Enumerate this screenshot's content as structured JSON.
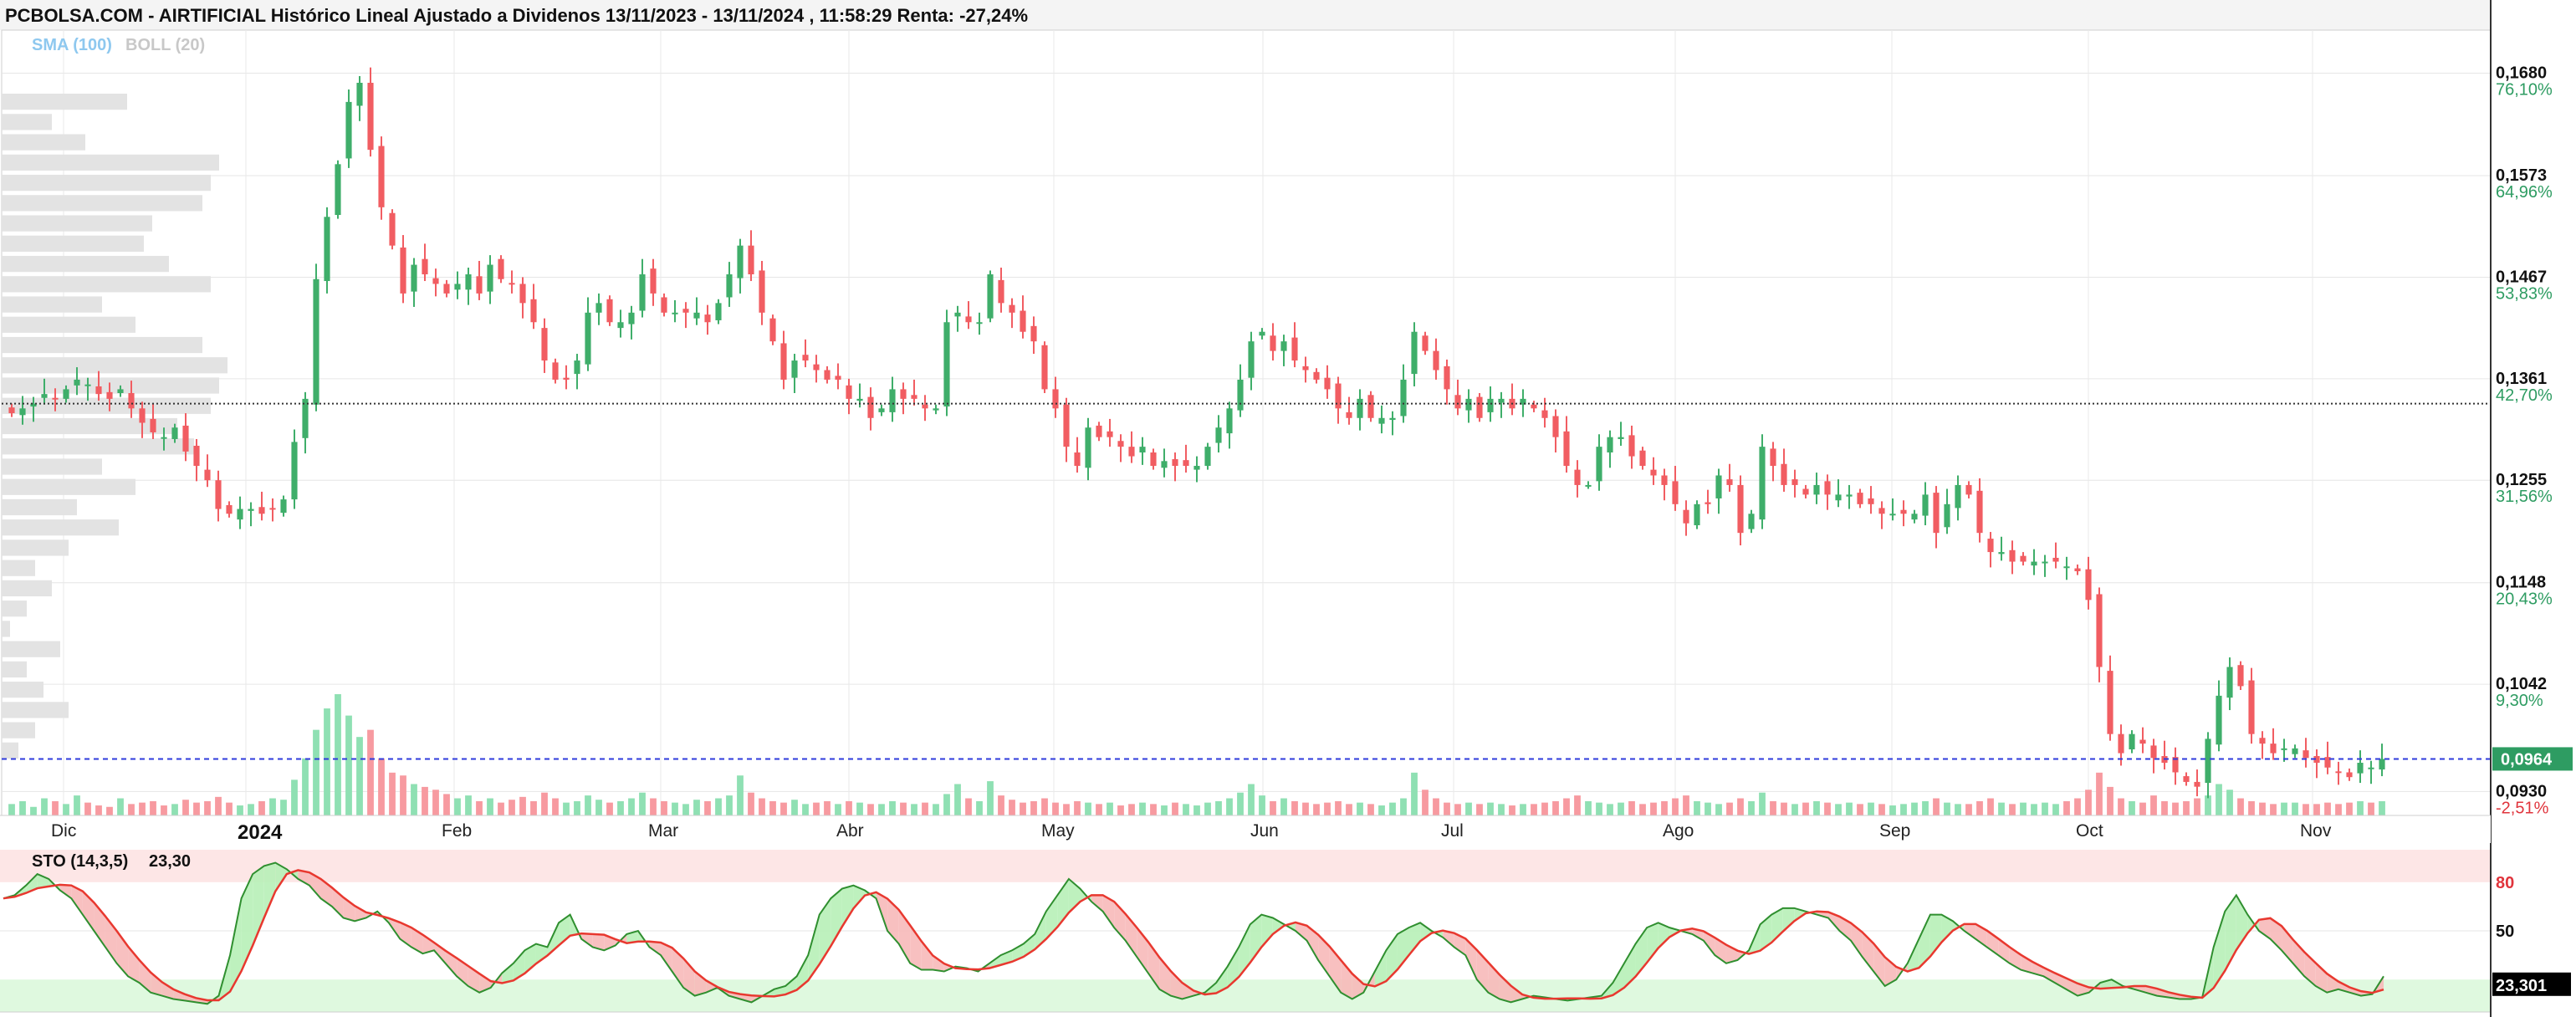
{
  "header": {
    "title": "PCBOLSA.COM - AIRTIFICIAL Histórico Lineal Ajustado a Dividenos 13/11/2023 - 13/11/2024 , 11:58:29 Renta: -27,24%",
    "legend_sma": "SMA (100)",
    "legend_boll": "BOLL (20)"
  },
  "chart_data": [
    {
      "type": "candlestick",
      "title": "PCBOLSA.COM - AIRTIFICIAL Histórico Lineal Ajustado a Dividenos 13/11/2023 - 13/11/2024 , 11:58:29 Renta: -27,24%",
      "ylim": [
        0.0905,
        0.1725
      ],
      "y_ticks": [
        {
          "value": "0,1680",
          "pct": "76,10%"
        },
        {
          "value": "0,1573",
          "pct": "64,96%"
        },
        {
          "value": "0,1467",
          "pct": "53,83%"
        },
        {
          "value": "0,1361",
          "pct": "42,70%"
        },
        {
          "value": "0,1255",
          "pct": "31,56%"
        },
        {
          "value": "0,1148",
          "pct": "20,43%"
        },
        {
          "value": "0,1042",
          "pct": "9,30%"
        },
        {
          "value": "0,0930",
          "pct": "-2,51%"
        }
      ],
      "y_tick_values": [
        0.168,
        0.1573,
        0.1467,
        0.1361,
        0.1255,
        0.1148,
        0.1042,
        0.093
      ],
      "x_months": [
        "Dic",
        "2024",
        "Feb",
        "Mar",
        "Abr",
        "May",
        "Jun",
        "Jul",
        "Ago",
        "Sep",
        "Oct",
        "Nov"
      ],
      "reference_price": 0.1335,
      "last_price": "0,0964",
      "last_price_value": 0.0964,
      "colors": {
        "up": "#3fae6a",
        "down": "#f15d62",
        "up_volume": "#8fe0b3",
        "down_volume": "#f79aa0",
        "last_price": "#2e9c62"
      },
      "close_series": [
        0.1325,
        0.133,
        0.1335,
        0.1345,
        0.134,
        0.135,
        0.136,
        0.1355,
        0.1345,
        0.134,
        0.135,
        0.133,
        0.1315,
        0.1305,
        0.13,
        0.131,
        0.1285,
        0.127,
        0.1255,
        0.1225,
        0.122,
        0.1225,
        0.1225,
        0.122,
        0.1225,
        0.1235,
        0.1295,
        0.134,
        0.1465,
        0.153,
        0.1585,
        0.165,
        0.167,
        0.16,
        0.154,
        0.15,
        0.145,
        0.148,
        0.147,
        0.146,
        0.145,
        0.146,
        0.147,
        0.145,
        0.148,
        0.1465,
        0.146,
        0.144,
        0.142,
        0.138,
        0.136,
        0.136,
        0.138,
        0.143,
        0.144,
        0.142,
        0.142,
        0.143,
        0.147,
        0.145,
        0.143,
        0.143,
        0.143,
        0.143,
        0.142,
        0.144,
        0.147,
        0.15,
        0.147,
        0.143,
        0.14,
        0.136,
        0.138,
        0.138,
        0.137,
        0.136,
        0.136,
        0.134,
        0.134,
        0.132,
        0.133,
        0.135,
        0.134,
        0.134,
        0.133,
        0.133,
        0.142,
        0.143,
        0.142,
        0.142,
        0.147,
        0.144,
        0.143,
        0.141,
        0.14,
        0.135,
        0.133,
        0.129,
        0.127,
        0.131,
        0.13,
        0.13,
        0.129,
        0.128,
        0.129,
        0.127,
        0.1275,
        0.127,
        0.127,
        0.127,
        0.129,
        0.131,
        0.133,
        0.136,
        0.14,
        0.141,
        0.139,
        0.14,
        0.138,
        0.137,
        0.136,
        0.135,
        0.133,
        0.132,
        0.134,
        0.132,
        0.132,
        0.132,
        0.136,
        0.141,
        0.139,
        0.137,
        0.135,
        0.133,
        0.134,
        0.132,
        0.134,
        0.134,
        0.133,
        0.134,
        0.133,
        0.132,
        0.13,
        0.127,
        0.125,
        0.125,
        0.129,
        0.13,
        0.13,
        0.128,
        0.127,
        0.126,
        0.125,
        0.123,
        0.121,
        0.123,
        0.123,
        0.126,
        0.125,
        0.12,
        0.122,
        0.129,
        0.127,
        0.125,
        0.125,
        0.124,
        0.125,
        0.124,
        0.124,
        0.124,
        0.123,
        0.123,
        0.122,
        0.122,
        0.122,
        0.122,
        0.124,
        0.12,
        0.123,
        0.125,
        0.124,
        0.12,
        0.118,
        0.118,
        0.117,
        0.117,
        0.117,
        0.117,
        0.117,
        0.1165,
        0.116,
        0.113,
        0.106,
        0.099,
        0.097,
        0.099,
        0.098,
        0.0965,
        0.096,
        0.095,
        0.094,
        0.0935,
        0.0985,
        0.103,
        0.106,
        0.104,
        0.099,
        0.098,
        0.097,
        0.0975,
        0.0975,
        0.0965,
        0.096,
        0.0955,
        0.095,
        0.0945,
        0.096,
        0.0955,
        0.0964
      ],
      "volume_series": [
        8,
        10,
        6,
        12,
        10,
        8,
        14,
        9,
        7,
        6,
        12,
        8,
        9,
        10,
        7,
        8,
        11,
        9,
        10,
        13,
        9,
        7,
        8,
        10,
        12,
        11,
        25,
        40,
        60,
        75,
        85,
        70,
        55,
        60,
        40,
        30,
        28,
        22,
        20,
        18,
        15,
        12,
        14,
        10,
        12,
        9,
        11,
        13,
        10,
        16,
        12,
        9,
        10,
        14,
        11,
        9,
        10,
        12,
        16,
        12,
        10,
        9,
        8,
        11,
        10,
        12,
        14,
        28,
        16,
        12,
        10,
        9,
        11,
        8,
        9,
        10,
        8,
        10,
        9,
        8,
        8,
        10,
        9,
        8,
        9,
        8,
        15,
        22,
        12,
        10,
        24,
        14,
        11,
        9,
        10,
        12,
        9,
        8,
        10,
        9,
        8,
        9,
        7,
        8,
        9,
        8,
        7,
        9,
        8,
        7,
        9,
        10,
        12,
        16,
        22,
        14,
        10,
        12,
        10,
        9,
        8,
        9,
        10,
        8,
        9,
        8,
        7,
        9,
        12,
        30,
        18,
        12,
        9,
        8,
        9,
        8,
        9,
        8,
        7,
        8,
        8,
        9,
        10,
        12,
        14,
        10,
        9,
        8,
        9,
        10,
        8,
        9,
        10,
        12,
        14,
        10,
        9,
        8,
        9,
        12,
        10,
        16,
        10,
        9,
        8,
        9,
        10,
        9,
        8,
        9,
        8,
        9,
        8,
        7,
        8,
        9,
        10,
        12,
        9,
        8,
        8,
        10,
        12,
        9,
        8,
        9,
        8,
        9,
        8,
        10,
        12,
        18,
        30,
        20,
        12,
        10,
        9,
        14,
        10,
        9,
        10,
        12,
        14,
        22,
        18,
        12,
        10,
        9,
        8,
        9,
        9,
        8,
        8,
        9,
        8,
        9,
        10,
        9,
        10
      ],
      "sto": {
        "label": "STO (14,3,5)",
        "value": "23,30",
        "last_value": "23,301",
        "levels": [
          80,
          50
        ],
        "k_series": [
          70,
          72,
          78,
          85,
          82,
          75,
          70,
          60,
          50,
          40,
          30,
          22,
          18,
          12,
          10,
          8,
          7,
          6,
          5,
          10,
          35,
          70,
          85,
          90,
          92,
          88,
          82,
          78,
          70,
          65,
          58,
          56,
          58,
          62,
          55,
          45,
          40,
          36,
          38,
          30,
          22,
          16,
          12,
          15,
          24,
          30,
          38,
          42,
          40,
          55,
          60,
          45,
          40,
          38,
          41,
          48,
          50,
          40,
          35,
          25,
          15,
          10,
          12,
          15,
          10,
          8,
          6,
          10,
          14,
          16,
          22,
          35,
          60,
          70,
          76,
          78,
          75,
          70,
          50,
          42,
          30,
          26,
          26,
          25,
          28,
          27,
          25,
          30,
          35,
          38,
          42,
          48,
          62,
          72,
          82,
          76,
          68,
          62,
          52,
          44,
          34,
          24,
          14,
          10,
          8,
          10,
          12,
          18,
          28,
          40,
          54,
          60,
          58,
          54,
          50,
          44,
          32,
          22,
          12,
          8,
          12,
          25,
          38,
          48,
          52,
          55,
          50,
          46,
          40,
          35,
          20,
          12,
          8,
          6,
          8,
          10,
          9,
          8,
          7,
          8,
          9,
          10,
          18,
          30,
          42,
          52,
          55,
          52,
          50,
          48,
          44,
          35,
          30,
          32,
          38,
          54,
          60,
          64,
          64,
          62,
          60,
          58,
          50,
          44,
          34,
          25,
          16,
          20,
          30,
          45,
          60,
          60,
          56,
          50,
          45,
          40,
          35,
          30,
          26,
          24,
          22,
          18,
          14,
          10,
          12,
          18,
          20,
          16,
          14,
          12,
          10,
          9,
          8,
          8,
          9,
          40,
          62,
          72,
          60,
          50,
          45,
          38,
          30,
          22,
          16,
          12,
          14,
          12,
          10,
          11,
          22
        ]
      }
    }
  ]
}
